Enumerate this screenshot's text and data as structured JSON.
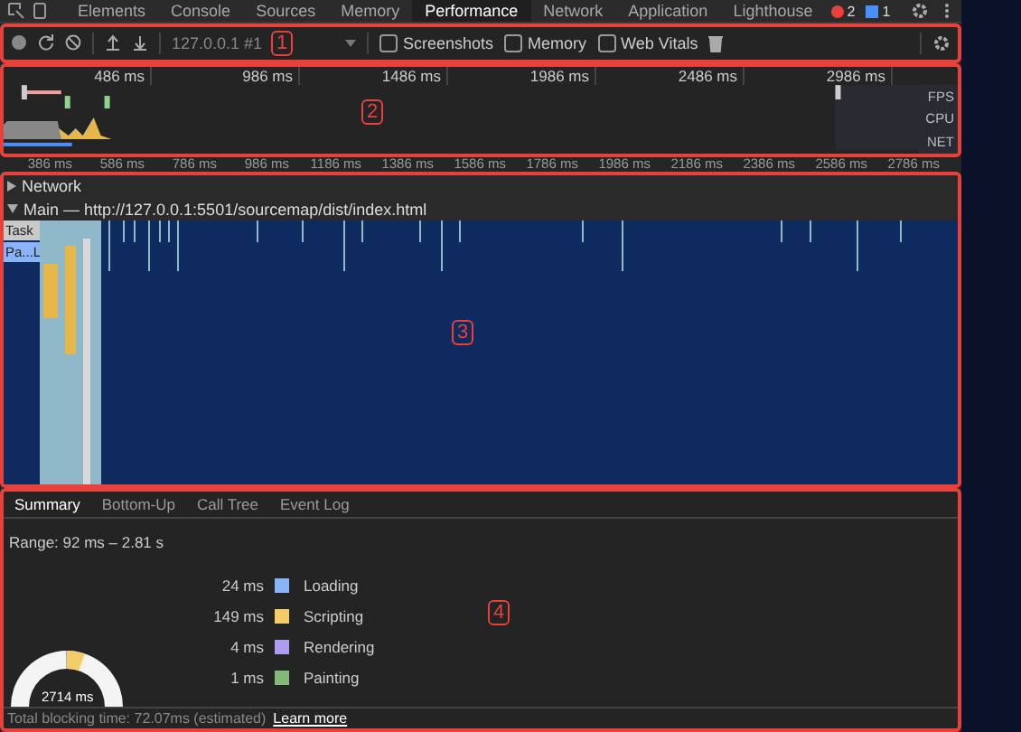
{
  "tabs": [
    {
      "label": "Elements",
      "selected": false
    },
    {
      "label": "Console",
      "selected": false
    },
    {
      "label": "Sources",
      "selected": false
    },
    {
      "label": "Memory",
      "selected": false
    },
    {
      "label": "Performance",
      "selected": true
    },
    {
      "label": "Network",
      "selected": false
    },
    {
      "label": "Application",
      "selected": false
    },
    {
      "label": "Lighthouse",
      "selected": false
    }
  ],
  "badges": {
    "errors": "2",
    "messages": "1"
  },
  "toolbar": {
    "target": "127.0.0.1 #1",
    "annotation": "1",
    "options": [
      {
        "label": "Screenshots",
        "checked": false
      },
      {
        "label": "Memory",
        "checked": false
      },
      {
        "label": "Web Vitals",
        "checked": false
      }
    ]
  },
  "overview": {
    "annotation": "2",
    "ticks": [
      "486 ms",
      "986 ms",
      "1486 ms",
      "1986 ms",
      "2486 ms",
      "2986 ms"
    ],
    "lanes": [
      "FPS",
      "CPU",
      "NET"
    ]
  },
  "ruler": [
    "386 ms",
    "586 ms",
    "786 ms",
    "986 ms",
    "1186 ms",
    "1386 ms",
    "1586 ms",
    "1786 ms",
    "1986 ms",
    "2186 ms",
    "2386 ms",
    "2586 ms",
    "2786 ms"
  ],
  "tracks": {
    "annotation": "3",
    "network": "Network",
    "main": "Main — http://127.0.0.1:5501/sourcemap/dist/index.html",
    "task": "Task",
    "parse": "Pa...L"
  },
  "details": {
    "annotation": "4",
    "tabs": [
      {
        "label": "Summary",
        "selected": true
      },
      {
        "label": "Bottom-Up",
        "selected": false
      },
      {
        "label": "Call Tree",
        "selected": false
      },
      {
        "label": "Event Log",
        "selected": false
      }
    ],
    "range": "Range: 92 ms – 2.81 s",
    "legend": [
      {
        "value": "24 ms",
        "label": "Loading",
        "color": "#8ab4f8"
      },
      {
        "value": "149 ms",
        "label": "Scripting",
        "color": "#f5cc6b"
      },
      {
        "value": "4 ms",
        "label": "Rendering",
        "color": "#ad9cf0"
      },
      {
        "value": "1 ms",
        "label": "Painting",
        "color": "#84b876"
      }
    ],
    "total": "2714 ms",
    "blocking": "Total blocking time: 72.07ms (estimated)",
    "link": "Learn more"
  }
}
